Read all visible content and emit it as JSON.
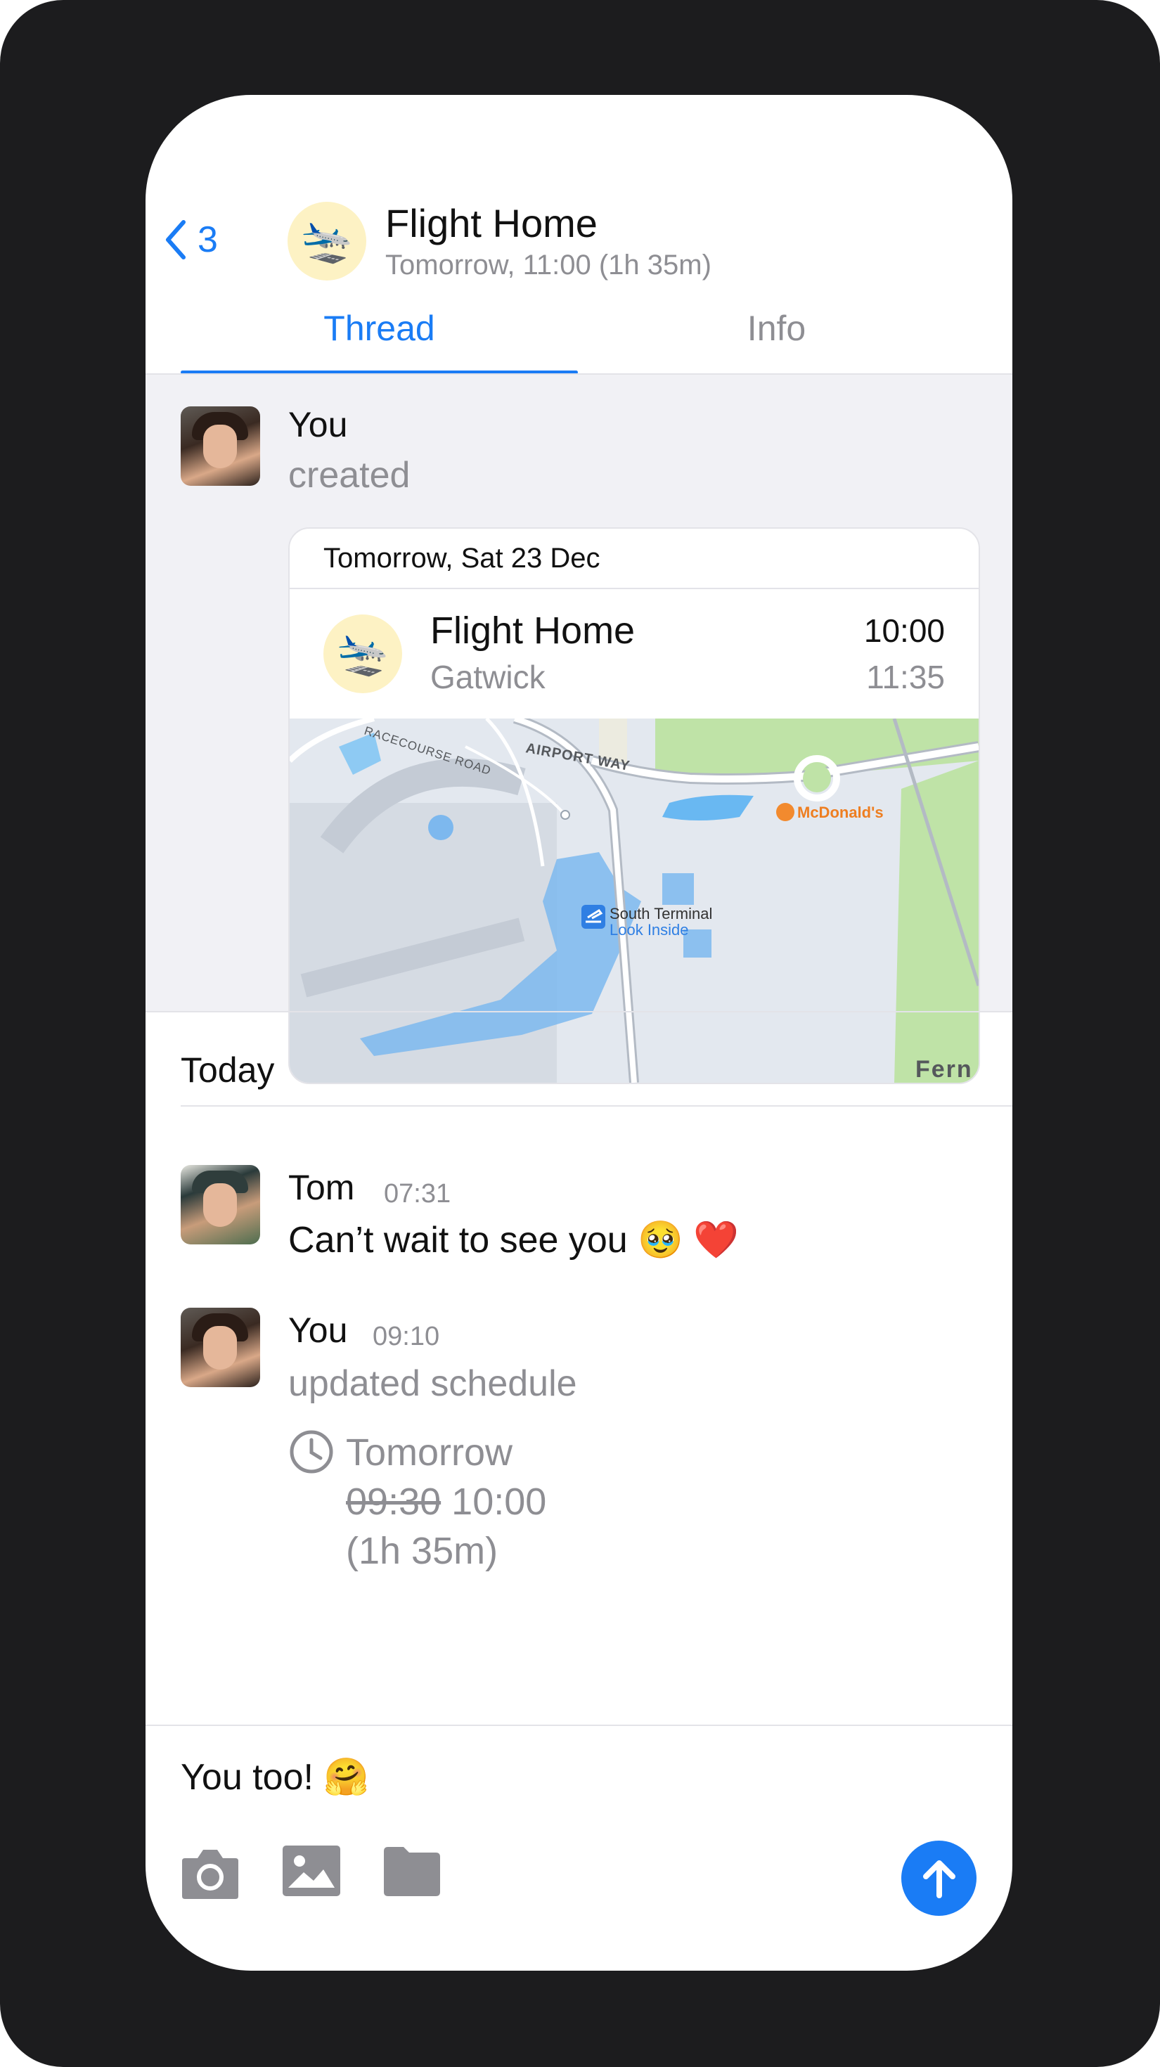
{
  "header": {
    "back_count": "3",
    "title": "Flight Home",
    "subtitle": "Tomorrow, 11:00 (1h 35m)",
    "avatar_emoji": "🛬"
  },
  "tabs": [
    {
      "label": "Thread",
      "active": true
    },
    {
      "label": "Info",
      "active": false
    }
  ],
  "created": {
    "author": "You",
    "action": "created",
    "card": {
      "date": "Tomorrow, Sat 23 Dec",
      "title": "Flight Home",
      "place": "Gatwick",
      "start": "10:00",
      "end": "11:35",
      "avatar_emoji": "🛬",
      "map": {
        "road_1": "RACECOURSE ROAD",
        "road_2": "AIRPORT WAY",
        "poi": "McDonald's",
        "terminal": "South Terminal",
        "terminal_link": "Look Inside",
        "edge_label": "Fern"
      }
    }
  },
  "section": {
    "today": "Today"
  },
  "messages": [
    {
      "author": "Tom",
      "time": "07:31",
      "text": "Can’t wait to see you 🥹 ❤️"
    },
    {
      "author": "You",
      "time": "09:10",
      "action": "updated schedule",
      "schedule": {
        "day": "Tomorrow",
        "old_time": "09:30",
        "new_time": "10:00",
        "duration": "(1h 35m)"
      }
    }
  ],
  "composer": {
    "text": "You too! 🤗",
    "tools": [
      "camera-icon",
      "image-icon",
      "folder-icon"
    ],
    "send_icon": "arrow-up-icon"
  },
  "colors": {
    "accent": "#1a7cf5",
    "muted": "#8e8e93",
    "frame": "#1c1c1e",
    "thread_bg": "#f1f1f5",
    "avatar_bg": "#fdf2c4"
  }
}
